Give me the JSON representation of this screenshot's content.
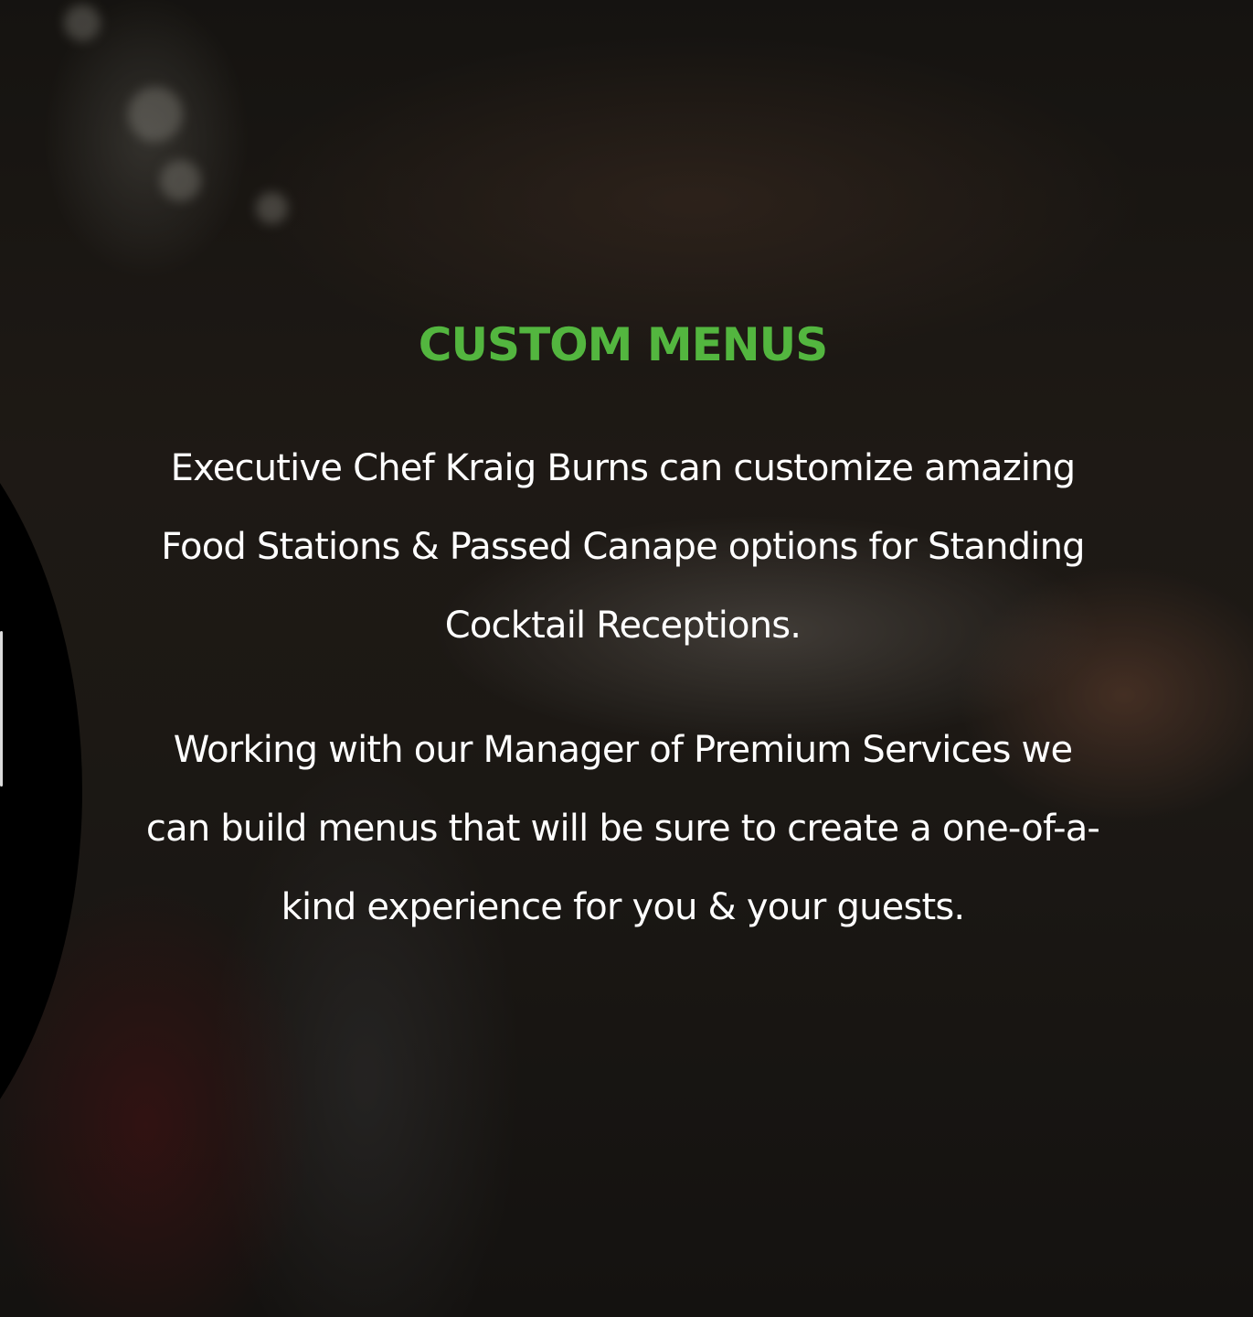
{
  "colors": {
    "title": "#53b63f",
    "body_text": "#ffffff",
    "background_dark": "#1d1a17"
  },
  "section": {
    "title": "CUSTOM MENUS",
    "paragraphs": [
      "Executive Chef Kraig Burns can customize amazing Food Stations & Passed Canape options for Standing Cocktail Receptions.",
      "Working with our Manager of Premium Services we can build menus that will be sure to create a one-of-a-kind experience for you & your guests."
    ]
  }
}
